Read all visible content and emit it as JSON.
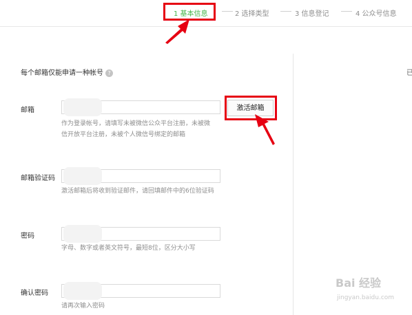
{
  "steps": [
    {
      "label": "1 基本信息",
      "active": true
    },
    {
      "label": "2 选择类型",
      "active": false
    },
    {
      "label": "3 信息登记",
      "active": false
    },
    {
      "label": "4 公众号信息",
      "active": false
    }
  ],
  "form": {
    "notice": "每个邮箱仅能申请一种帐号",
    "help_icon": "?",
    "email": {
      "label": "邮箱",
      "hint": "作为登录帐号，请填写未被微信公众平台注册，未被微信开放平台注册，未被个人微信号绑定的邮箱",
      "activate_button": "激活邮箱"
    },
    "verify_code": {
      "label": "邮箱验证码",
      "hint": "激活邮箱后将收到验证邮件，请回填邮件中的6位验证码"
    },
    "password": {
      "label": "密码",
      "hint": "字母、数字或者英文符号，最短8位，区分大小写"
    },
    "confirm_password": {
      "label": "确认密码",
      "hint": "请再次输入密码"
    }
  },
  "side": {
    "partial_text": "已"
  },
  "watermark": {
    "brand": "Bai 经验",
    "url": "jingyan.baidu.com"
  },
  "colors": {
    "active_step": "#44b549",
    "highlight": "#e60012"
  }
}
